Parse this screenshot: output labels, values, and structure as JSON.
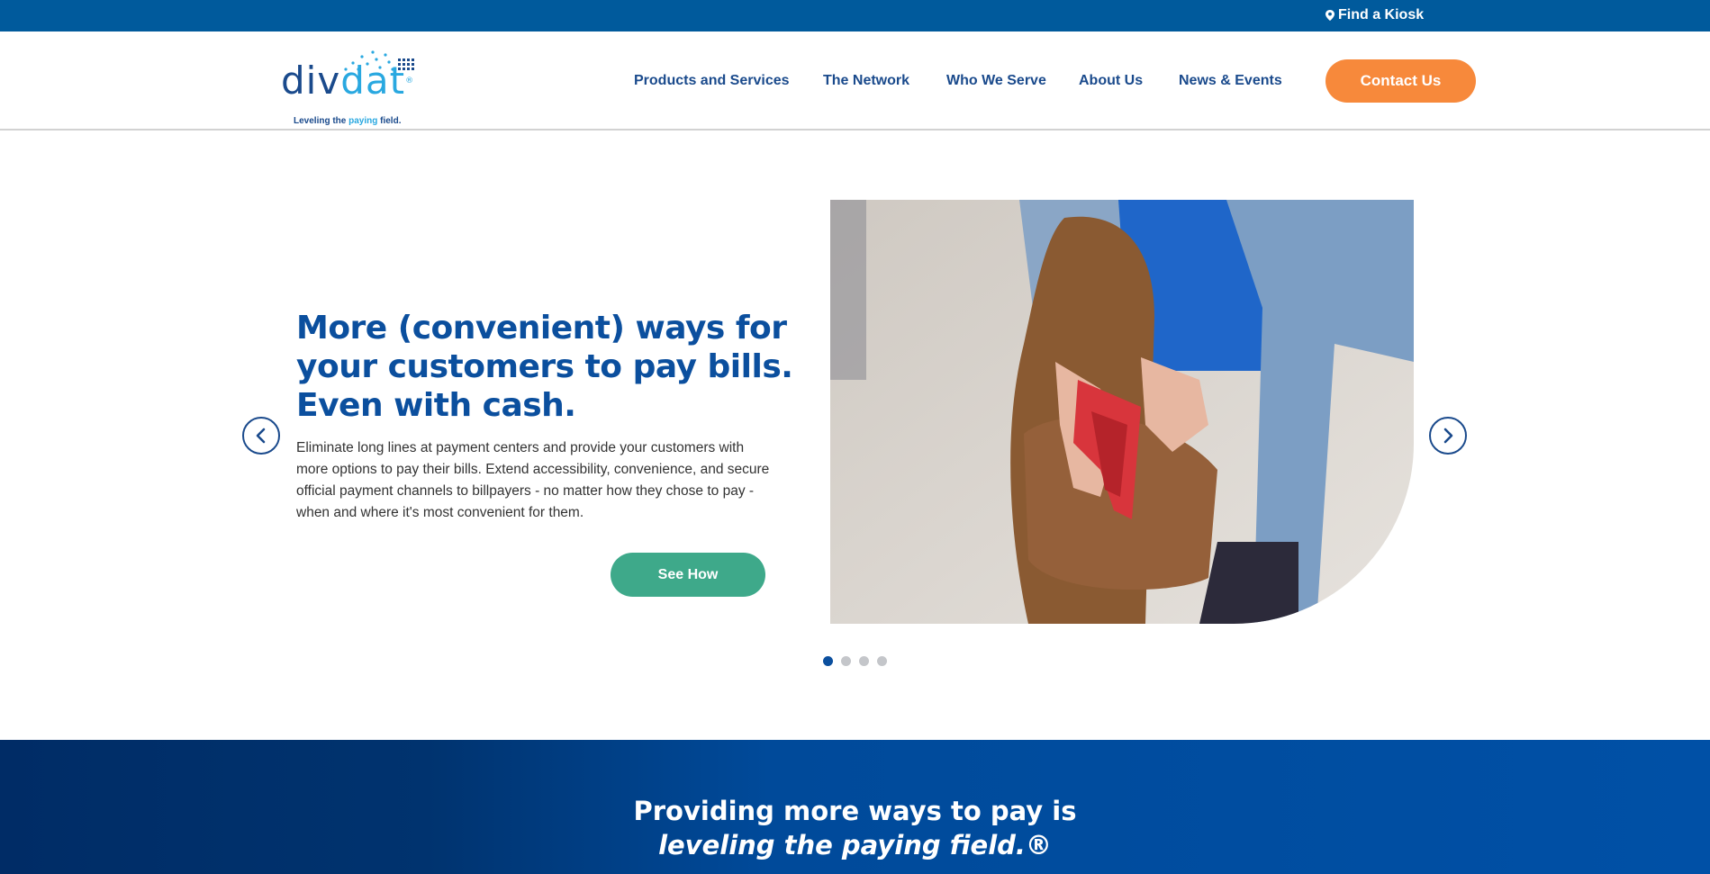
{
  "topbar": {
    "kiosk_label": "Find a Kiosk"
  },
  "logo": {
    "word_part1": "div",
    "word_part2": "dat",
    "trademark": "®",
    "tagline_a": "Leveling the ",
    "tagline_highlight": "paying",
    "tagline_b": " field."
  },
  "nav": {
    "items": [
      {
        "label": "Products and Services"
      },
      {
        "label": "The Network"
      },
      {
        "label": "Who We Serve"
      },
      {
        "label": "About Us"
      },
      {
        "label": "News & Events"
      }
    ],
    "contact_label": "Contact Us"
  },
  "hero": {
    "title": "More (convenient) ways for your customers to pay bills. Even with cash.",
    "body": "Eliminate long lines at payment centers and provide your customers with more options to pay their bills. Extend accessibility, convenience, and secure official payment channels to billpayers - no matter how they chose to pay - when and where it's most convenient for them.",
    "cta_label": "See How",
    "slide_count": 4,
    "active_slide": 1
  },
  "band": {
    "line1": "Providing more ways to pay is",
    "line2": "leveling the paying field.®"
  },
  "colors": {
    "topbar": "#005a9c",
    "brand_blue": "#0b4f9e",
    "accent_orange": "#f7893b",
    "cta_green": "#3ea98a"
  },
  "icons": {
    "kiosk": "map-pin-icon",
    "prev": "chevron-left-icon",
    "next": "chevron-right-icon"
  }
}
